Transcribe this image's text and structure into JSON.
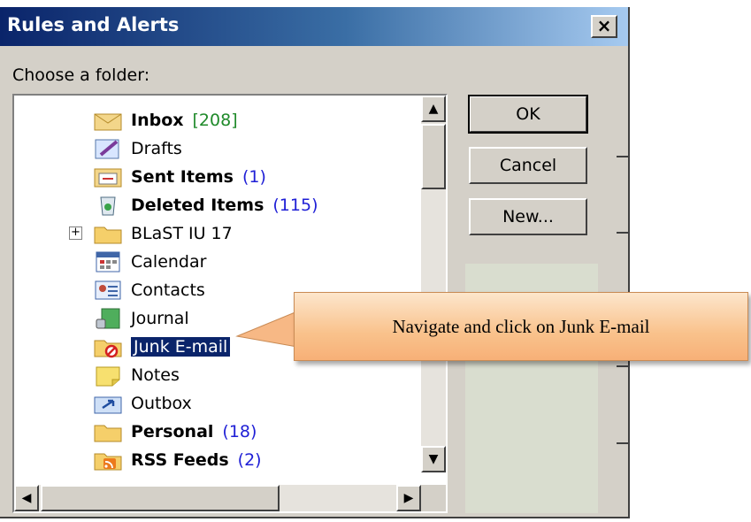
{
  "dialog": {
    "title": "Rules and Alerts",
    "close_symbol": "×",
    "prompt": "Choose a folder:"
  },
  "folders": [
    {
      "name": "Inbox",
      "count": "[208]",
      "bold": true,
      "icon": "inbox-icon"
    },
    {
      "name": "Drafts",
      "count": "",
      "bold": false,
      "icon": "drafts-icon"
    },
    {
      "name": "Sent Items",
      "count": "(1)",
      "bold": true,
      "icon": "sent-items-icon"
    },
    {
      "name": "Deleted Items",
      "count": "(115)",
      "bold": true,
      "icon": "deleted-items-icon"
    },
    {
      "name": "BLaST IU 17",
      "count": "",
      "bold": false,
      "icon": "folder-icon",
      "expander": "+"
    },
    {
      "name": "Calendar",
      "count": "",
      "bold": false,
      "icon": "calendar-icon"
    },
    {
      "name": "Contacts",
      "count": "",
      "bold": false,
      "icon": "contacts-icon"
    },
    {
      "name": "Journal",
      "count": "",
      "bold": false,
      "icon": "journal-icon"
    },
    {
      "name": "Junk E-mail",
      "count": "",
      "bold": false,
      "icon": "junk-email-icon",
      "selected": true
    },
    {
      "name": "Notes",
      "count": "",
      "bold": false,
      "icon": "notes-icon"
    },
    {
      "name": "Outbox",
      "count": "",
      "bold": false,
      "icon": "outbox-icon"
    },
    {
      "name": "Personal",
      "count": "(18)",
      "bold": true,
      "icon": "folder-icon"
    },
    {
      "name": "RSS Feeds",
      "count": "(2)",
      "bold": true,
      "icon": "rss-feeds-icon"
    }
  ],
  "buttons": {
    "ok": "OK",
    "cancel": "Cancel",
    "new": "New..."
  },
  "scroll_arrows": {
    "up": "▲",
    "down": "▼",
    "left": "◀",
    "right": "▶"
  },
  "callout": {
    "text": "Navigate and click on Junk E-mail"
  },
  "colors": {
    "titlebar": "#0a246a",
    "selection": "#0a246a",
    "count_blue": "#1f1fd6",
    "count_green": "#1f8a2a",
    "callout": "#f9c28c"
  }
}
